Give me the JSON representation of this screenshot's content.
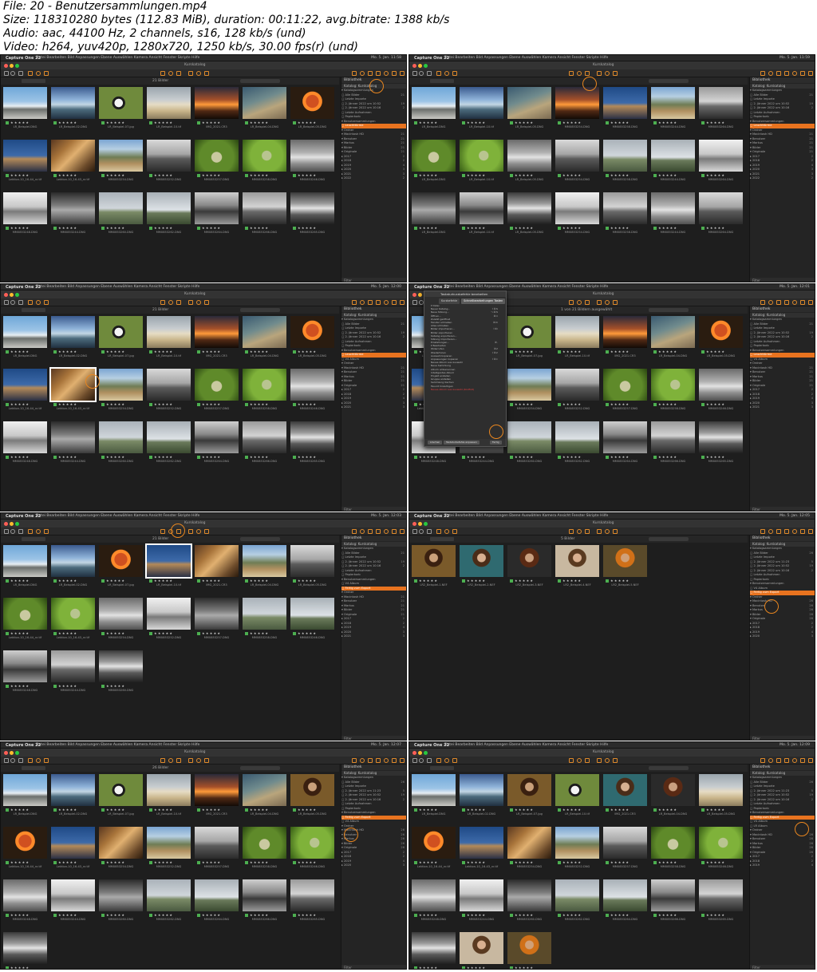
{
  "info": {
    "lines": [
      "File: 20 - Benutzersammlungen.mp4",
      "Size: 118310280 bytes (112.83 MiB), duration: 00:11:22, avg.bitrate: 1388 kb/s",
      "Audio: aac, 44100 Hz, 2 channels, s16, 128 kb/s (und)",
      "Video: h264, yuv420p, 1280x720, 1250 kb/s, 30.00 fps(r) (und)"
    ]
  },
  "app": {
    "name": "Capture One 22",
    "menus": "Datei   Bearbeiten   Bild   Anpassungen   Ebene   Auswählen   Kamera   Ansicht   Fenster   Skripte   Hilfe",
    "window_title": "Kurskatalog",
    "panel_title": "Bibliothek",
    "panel_section": "Katalog: Kurskatalog",
    "filter_label": "Filter"
  },
  "frames": [
    {
      "id": "f1",
      "clock": "Mo. 5. Jan. 11:58",
      "count": "21 Bilder",
      "tree": [
        {
          "t": "▾ Katalogsammlungen",
          "n": ""
        },
        {
          "t": "   ▢ Alle Bilder",
          "n": "21"
        },
        {
          "t": "   ▢ Letzte Importe",
          "n": ""
        },
        {
          "t": "     ▢ 2. Jänner 2022 um 10:52",
          "n": "19"
        },
        {
          "t": "     ▢ 2. Jänner 2022 um 10:16",
          "n": "2"
        },
        {
          "t": "   ▢ Letzte Aufnahmen",
          "n": ""
        },
        {
          "t": "   ▢ Papierkorb",
          "n": ""
        },
        {
          "t": "▾ Benutzersammlungen",
          "n": ""
        },
        {
          "t": "   ▢ Leuchttürme",
          "n": "",
          "hl": true
        },
        {
          "t": "▾ Ordner",
          "n": ""
        },
        {
          "t": "   ▾ Macintosh HD",
          "n": "21"
        },
        {
          "t": "     ▾ Benutzer",
          "n": "21"
        },
        {
          "t": "       ▾ Markus",
          "n": "21"
        },
        {
          "t": "         ▾ Bilder",
          "n": "21"
        },
        {
          "t": "           ▾ Originale",
          "n": "21"
        },
        {
          "t": "             ▸ 2017",
          "n": "2"
        },
        {
          "t": "             ▸ 2018",
          "n": "2"
        },
        {
          "t": "             ▸ 2019",
          "n": "4"
        },
        {
          "t": "             ▸ 2020",
          "n": "3"
        },
        {
          "t": "             ▸ 2021",
          "n": "3"
        },
        {
          "t": "             ▸ 2022",
          "n": "2"
        }
      ]
    },
    {
      "id": "f2",
      "clock": "Mo. 5. Jan. 11:59",
      "count": "",
      "tree": [
        {
          "t": "▾ Katalogsammlungen",
          "n": ""
        },
        {
          "t": "   ▢ Alle Bilder",
          "n": "21"
        },
        {
          "t": "   ▢ Letzte Importe",
          "n": ""
        },
        {
          "t": "     ▢ 2. Jänner 2022 um 10:52",
          "n": "19"
        },
        {
          "t": "     ▢ 2. Jänner 2022 um 10:16",
          "n": "2"
        },
        {
          "t": "   ▢ Letzte Aufnahmen",
          "n": ""
        },
        {
          "t": "   ▢ Papierkorb",
          "n": ""
        },
        {
          "t": "▾ Benutzersammlungen",
          "n": ""
        },
        {
          "t": "   ▢ Leuchttürme",
          "n": "",
          "hl": true
        },
        {
          "t": "▾ Ordner",
          "n": ""
        },
        {
          "t": "   ▾ Macintosh HD",
          "n": "21"
        },
        {
          "t": "     ▾ Benutzer",
          "n": "21"
        },
        {
          "t": "       ▾ Markus",
          "n": "21"
        },
        {
          "t": "         ▾ Bilder",
          "n": "21"
        },
        {
          "t": "           ▾ Originale",
          "n": "21"
        },
        {
          "t": "             ▸ 2017",
          "n": "2"
        },
        {
          "t": "             ▸ 2018",
          "n": "2"
        },
        {
          "t": "             ▸ 2019",
          "n": "4"
        },
        {
          "t": "             ▸ 2020",
          "n": "3"
        },
        {
          "t": "             ▸ 2021",
          "n": "3"
        },
        {
          "t": "             ▸ 2022",
          "n": "2"
        }
      ]
    },
    {
      "id": "f3",
      "clock": "Mo. 5. Jan. 12:00",
      "count": "21 Bilder",
      "tree": [
        {
          "t": "▾ Katalogsammlungen",
          "n": ""
        },
        {
          "t": "   ▢ Alle Bilder",
          "n": "21"
        },
        {
          "t": "   ▢ Letzte Importe",
          "n": ""
        },
        {
          "t": "     ▢ 2. Jänner 2022 um 10:52",
          "n": "19"
        },
        {
          "t": "     ▢ 2. Jänner 2022 um 10:16",
          "n": "2"
        },
        {
          "t": "   ▢ Letzte Aufnahmen",
          "n": ""
        },
        {
          "t": "   ▢ Papierkorb",
          "n": ""
        },
        {
          "t": "▾ Benutzersammlungen",
          "n": ""
        },
        {
          "t": "   ▢ Leuchttürme",
          "n": "",
          "hl": true
        },
        {
          "t": "   ▢ V4 Album",
          "n": ""
        },
        {
          "t": "▾ Ordner",
          "n": ""
        },
        {
          "t": "   ▾ Macintosh HD",
          "n": "21"
        },
        {
          "t": "     ▾ Benutzer",
          "n": "21"
        },
        {
          "t": "       ▾ Markus",
          "n": "21"
        },
        {
          "t": "         ▾ Bilder",
          "n": "21"
        },
        {
          "t": "           ▾ Originale",
          "n": "21"
        },
        {
          "t": "             ▸ 2017",
          "n": "2"
        },
        {
          "t": "             ▸ 2018",
          "n": "2"
        },
        {
          "t": "             ▸ 2019",
          "n": "4"
        },
        {
          "t": "             ▸ 2020",
          "n": "3"
        },
        {
          "t": "             ▸ 2021",
          "n": "3"
        }
      ]
    },
    {
      "id": "f4",
      "clock": "Mo. 5. Jan. 12:01",
      "count": "1 von 21 Bildern ausgewählt",
      "dialog": {
        "title": "Tastaturkurzbefehle bearbeiten",
        "tabs": [
          "Kurzbefehle",
          "Schnellbearbeitungen Tasten"
        ],
        "rows": [
          {
            "t": "▾ Datei",
            "k": ""
          },
          {
            "t": "   Neuer Katalog...",
            "k": "⇧⌘N"
          },
          {
            "t": "   Neue Sitzung...",
            "k": "⌥⌘N"
          },
          {
            "t": "   Öffnen...",
            "k": "⌘O"
          },
          {
            "t": "   Zuletzt geöffnet",
            "k": ""
          },
          {
            "t": "   Fenster schließen",
            "k": "⌘W"
          },
          {
            "t": "   Alles schließen",
            "k": ""
          },
          {
            "t": "   Bilder importieren...",
            "k": "⇧⌘I"
          },
          {
            "t": "   Bilder exportieren",
            "k": ""
          },
          {
            "t": "   Katalog exportieren...",
            "k": ""
          },
          {
            "t": "   Sitzung importieren...",
            "k": ""
          },
          {
            "t": "   Einstellungen...",
            "k": "⌘,"
          },
          {
            "t": "▾ Bearbeiten",
            "k": ""
          },
          {
            "t": "   Widerrufen",
            "k": "⌘Z"
          },
          {
            "t": "   Wiederholen",
            "k": "⇧⌘Z"
          },
          {
            "t": "   Auswahl kopieren",
            "k": ""
          },
          {
            "t": "   Anpassungen kopieren",
            "k": "⇧⌘C"
          },
          {
            "t": "   Neues Album aus Auswahl",
            "k": ""
          },
          {
            "t": "   Neue Sammlung",
            "k": ""
          },
          {
            "t": "   Album umbenennen",
            "k": ""
          },
          {
            "t": "   Intelligentes Album",
            "k": ""
          },
          {
            "t": "   Projekt erstellen",
            "k": ""
          },
          {
            "t": "   Gruppe erstellen",
            "k": ""
          },
          {
            "t": "   Sammlung löschen",
            "k": ""
          },
          {
            "t": "   Favorit hinzufügen",
            "k": ""
          }
        ],
        "red_row": "Neues Album aus Auswahl (Konflikt)",
        "btn_left": "Löschen",
        "btn_mid": "Tastaturbefehle anpassen",
        "btn_right": "Fertig"
      },
      "tree": [
        {
          "t": "▾ Katalogsammlungen",
          "n": ""
        },
        {
          "t": "   ▢ Alle Bilder",
          "n": "21"
        },
        {
          "t": "   ▢ Letzte Importe",
          "n": ""
        },
        {
          "t": "     ▢ 2. Jänner 2022 um 10:52",
          "n": "19"
        },
        {
          "t": "     ▢ 2. Jänner 2022 um 10:16",
          "n": "2"
        },
        {
          "t": "   ▢ Letzte Aufnahmen",
          "n": ""
        },
        {
          "t": "   ▢ Papierkorb",
          "n": ""
        },
        {
          "t": "▾ Benutzersammlungen",
          "n": ""
        },
        {
          "t": "   ▢ Leuchttürme",
          "n": "",
          "hl": true
        },
        {
          "t": "   ▢ V4 Album",
          "n": ""
        },
        {
          "t": "▾ Ordner",
          "n": ""
        },
        {
          "t": "   ▾ Macintosh HD",
          "n": "21"
        },
        {
          "t": "     ▾ Benutzer",
          "n": "21"
        },
        {
          "t": "       ▾ Markus",
          "n": "21"
        },
        {
          "t": "         ▾ Bilder",
          "n": "21"
        },
        {
          "t": "           ▾ Originale",
          "n": "21"
        },
        {
          "t": "             ▸ 2017",
          "n": "2"
        },
        {
          "t": "             ▸ 2018",
          "n": "2"
        },
        {
          "t": "             ▸ 2019",
          "n": "4"
        },
        {
          "t": "             ▸ 2020",
          "n": "3"
        },
        {
          "t": "             ▸ 2021",
          "n": "3"
        }
      ]
    },
    {
      "id": "f5",
      "clock": "Mo. 5. Jan. 12:03",
      "count": "21 Bilder",
      "tree": [
        {
          "t": "▾ Katalogsammlungen",
          "n": ""
        },
        {
          "t": "   ▢ Alle Bilder",
          "n": "21"
        },
        {
          "t": "   ▢ Letzte Importe",
          "n": ""
        },
        {
          "t": "     ▢ 2. Jänner 2022 um 10:52",
          "n": "19"
        },
        {
          "t": "     ▢ 2. Jänner 2022 um 10:16",
          "n": "2"
        },
        {
          "t": "   ▢ Letzte Aufnahmen",
          "n": ""
        },
        {
          "t": "   ▢ Papierkorb",
          "n": ""
        },
        {
          "t": "▾ Benutzersammlungen",
          "n": ""
        },
        {
          "t": "   ▢ V4 Album",
          "n": ""
        },
        {
          "t": "   ▢ Fertig zum Export",
          "n": "",
          "hl": true
        },
        {
          "t": "▾ Ordner",
          "n": ""
        },
        {
          "t": "   ▾ Macintosh HD",
          "n": "21"
        },
        {
          "t": "     ▾ Benutzer",
          "n": "21"
        },
        {
          "t": "       ▾ Markus",
          "n": "21"
        },
        {
          "t": "         ▾ Bilder",
          "n": "21"
        },
        {
          "t": "           ▾ Originale",
          "n": "21"
        },
        {
          "t": "             ▸ 2017",
          "n": "2"
        },
        {
          "t": "             ▸ 2018",
          "n": "2"
        },
        {
          "t": "             ▸ 2019",
          "n": "4"
        },
        {
          "t": "             ▸ 2020",
          "n": "3"
        },
        {
          "t": "             ▸ 2021",
          "n": "3"
        }
      ]
    },
    {
      "id": "f6",
      "clock": "Mo. 5. Jan. 12:05",
      "count": "5 Bilder",
      "tree": [
        {
          "t": "▾ Katalogsammlungen",
          "n": ""
        },
        {
          "t": "   ▢ Alle Bilder",
          "n": "26"
        },
        {
          "t": "   ▢ Letzte Importe",
          "n": ""
        },
        {
          "t": "     ▢ 2. Jänner 2022 um 11:23",
          "n": "5"
        },
        {
          "t": "     ▢ 2. Jänner 2022 um 10:52",
          "n": "19"
        },
        {
          "t": "     ▢ 2. Jänner 2022 um 10:16",
          "n": "2"
        },
        {
          "t": "   ▢ Letzte Aufnahmen",
          "n": ""
        },
        {
          "t": "   ▢ Papierkorb",
          "n": ""
        },
        {
          "t": "▾ Benutzersammlungen",
          "n": ""
        },
        {
          "t": "   ▢ V4 Album",
          "n": ""
        },
        {
          "t": "   ▢ Fertig zum Export",
          "n": "",
          "hl": true
        },
        {
          "t": "▾ Ordner",
          "n": ""
        },
        {
          "t": "   ▾ Macintosh HD",
          "n": "26"
        },
        {
          "t": "     ▾ Benutzer",
          "n": "26"
        },
        {
          "t": "       ▾ Markus",
          "n": "26"
        },
        {
          "t": "         ▾ Bilder",
          "n": "26"
        },
        {
          "t": "           ▾ Originale",
          "n": "26"
        },
        {
          "t": "             ▸ 2017",
          "n": "2"
        },
        {
          "t": "             ▸ 2018",
          "n": "2"
        },
        {
          "t": "             ▸ 2019",
          "n": "4"
        },
        {
          "t": "             ▸ 2020",
          "n": "3"
        }
      ]
    },
    {
      "id": "f7",
      "clock": "Mo. 5. Jan. 12:07",
      "count": "26 Bilder",
      "tree": [
        {
          "t": "▾ Katalogsammlungen",
          "n": ""
        },
        {
          "t": "   ▢ Alle Bilder",
          "n": "26"
        },
        {
          "t": "   ▢ Letzte Importe",
          "n": ""
        },
        {
          "t": "     ▢ 2. Jänner 2022 um 11:23",
          "n": "5"
        },
        {
          "t": "     ▢ 2. Jänner 2022 um 10:52",
          "n": "19"
        },
        {
          "t": "     ▢ 2. Jänner 2022 um 10:16",
          "n": "2"
        },
        {
          "t": "   ▢ Letzte Aufnahmen",
          "n": ""
        },
        {
          "t": "   ▢ Papierkorb",
          "n": ""
        },
        {
          "t": "▾ Benutzersammlungen",
          "n": ""
        },
        {
          "t": "   ▢ Fertig zum Export",
          "n": "",
          "hl": true
        },
        {
          "t": "   ▢ V4 Album",
          "n": ""
        },
        {
          "t": "▾ Ordner",
          "n": ""
        },
        {
          "t": "   ▾ Macintosh HD",
          "n": "26"
        },
        {
          "t": "     ▾ Benutzer",
          "n": "26"
        },
        {
          "t": "       ▾ Markus",
          "n": "26"
        },
        {
          "t": "         ▾ Bilder",
          "n": "26"
        },
        {
          "t": "           ▾ Originale",
          "n": "26"
        },
        {
          "t": "             ▸ 2017",
          "n": "2"
        },
        {
          "t": "             ▸ 2018",
          "n": "2"
        },
        {
          "t": "             ▸ 2019",
          "n": "4"
        },
        {
          "t": "             ▸ 2020",
          "n": "3"
        }
      ]
    },
    {
      "id": "f8",
      "clock": "Mo. 5. Jan. 12:09",
      "count": "",
      "tree": [
        {
          "t": "▾ Katalogsammlungen",
          "n": ""
        },
        {
          "t": "   ▢ Alle Bilder",
          "n": "26"
        },
        {
          "t": "   ▢ Letzte Importe",
          "n": ""
        },
        {
          "t": "     ▢ 2. Jänner 2022 um 11:23",
          "n": "5"
        },
        {
          "t": "     ▢ 2. Jänner 2022 um 10:52",
          "n": "19"
        },
        {
          "t": "     ▢ 2. Jänner 2022 um 10:16",
          "n": "2"
        },
        {
          "t": "   ▢ Letzte Aufnahmen",
          "n": ""
        },
        {
          "t": "   ▢ Papierkorb",
          "n": ""
        },
        {
          "t": "▾ Benutzersammlungen",
          "n": ""
        },
        {
          "t": "   ▢ Fertig zum Export",
          "n": "",
          "hl": true
        },
        {
          "t": "     ▢ V4 Album",
          "n": ""
        },
        {
          "t": "     ▢ LR Album",
          "n": ""
        },
        {
          "t": "▾ Ordner",
          "n": ""
        },
        {
          "t": "   ▾ Macintosh HD",
          "n": "26"
        },
        {
          "t": "     ▾ Benutzer",
          "n": "26"
        },
        {
          "t": "       ▾ Markus",
          "n": "26"
        },
        {
          "t": "         ▾ Bilder",
          "n": "26"
        },
        {
          "t": "           ▾ Originale",
          "n": "26"
        },
        {
          "t": "             ▸ 2017",
          "n": "2"
        },
        {
          "t": "             ▸ 2018",
          "n": "2"
        },
        {
          "t": "             ▸ 2019",
          "n": "4"
        }
      ]
    }
  ],
  "thumb_names": [
    "LR_Beispiel.DNG",
    "LR_Beispiel-02.DNG",
    "LR_Beispiel-07.jpg",
    "LR_Beispiel-10.tif",
    "IMG_2021.CR3",
    "LR_Beispiel-04.DNG",
    "LR_Beispiel-05.DNG",
    "Lektion-10_16-44_nr.tif",
    "Lektion-10_16-43_nr.tif",
    "MM0853254.DNG",
    "MM0853252.DNG",
    "MM0853257.DNG",
    "MM0853258.DNG",
    "MM0853246.DNG",
    "MM0853248.DNG",
    "MM0853244.DNG",
    "MM0853260.DNG",
    "MM0853262.DNG",
    "MM0853264.DNG",
    "MM0853266.DNG",
    "MM0853265.DNG",
    "LR2_Beispiel-1.NEF",
    "LR2_Beispiel-2.NEF",
    "LR2_Beispiel-3.NEF",
    "LR2_Beispiel-4.NEF",
    "LR2_Beispiel-5.NEF"
  ],
  "stars": "★ ★ ★ ★ ★",
  "colors": {
    "accent": "#e8731f",
    "bg": "#1e1e1e",
    "panel": "#242424"
  }
}
